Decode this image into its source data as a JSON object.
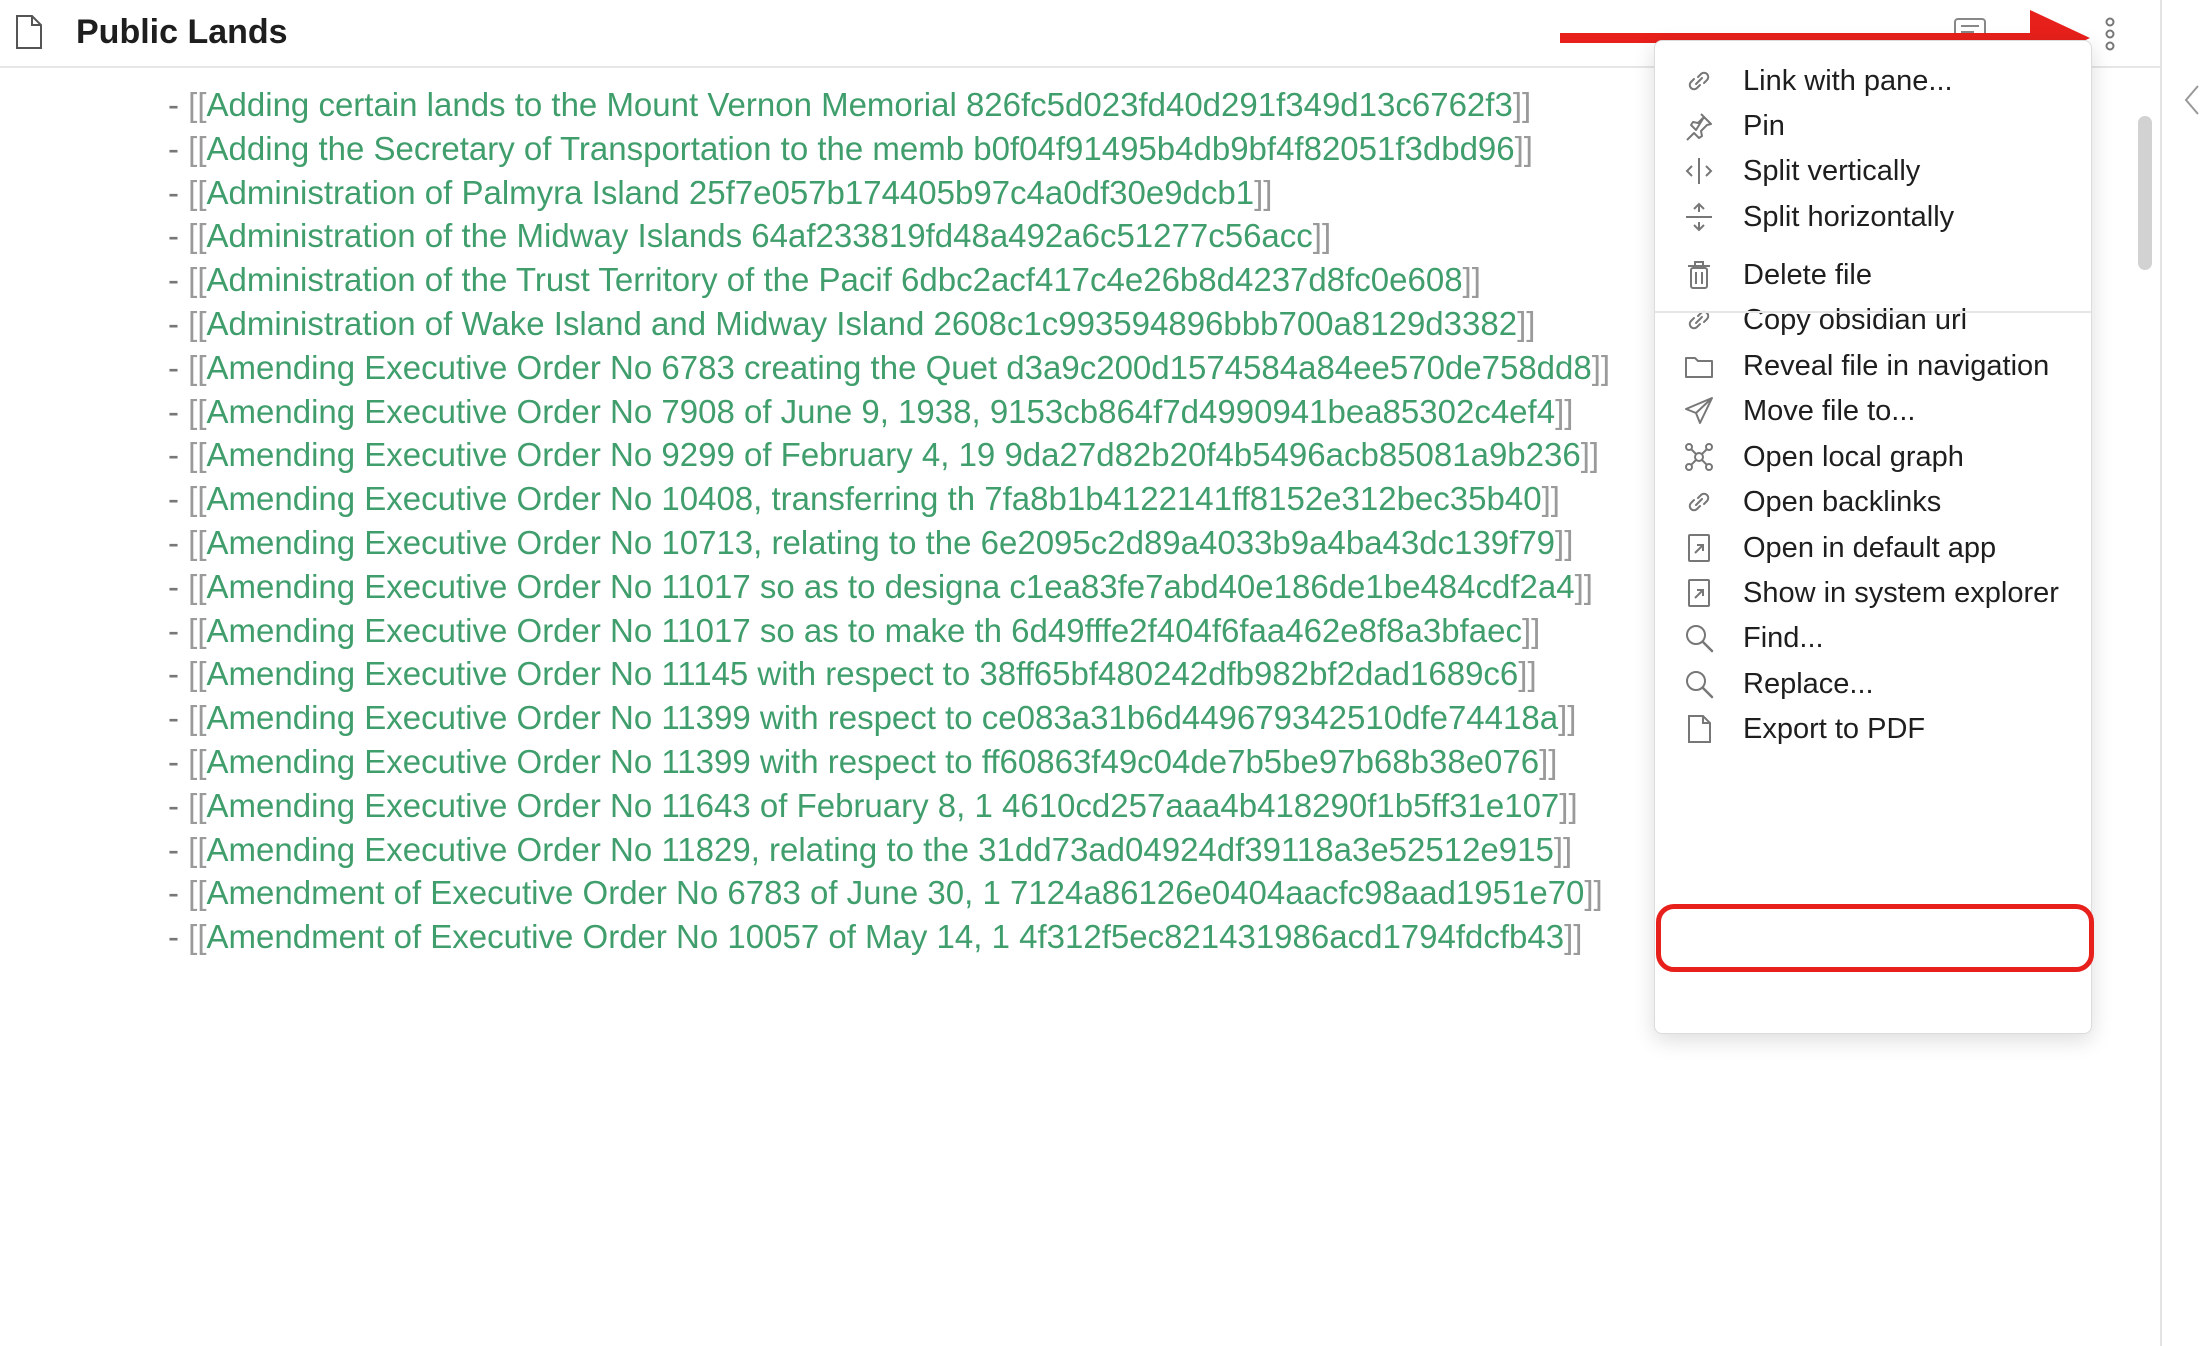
{
  "header": {
    "title": "Public Lands",
    "file_icon": "file-icon",
    "reading_icon": "reading-view-icon",
    "more_icon": "more-options-icon"
  },
  "list": {
    "bullet": "- ",
    "open": "[[",
    "close": "]]",
    "items": [
      "Adding certain lands to the Mount Vernon Memorial  826fc5d023fd40d291f349d13c6762f3",
      "Adding the Secretary of Transportation to the memb b0f04f91495b4db9bf4f82051f3dbd96",
      "Administration of Palmyra Island 25f7e057b174405b97c4a0df30e9dcb1",
      "Administration of the Midway Islands 64af233819fd48a492a6c51277c56acc",
      "Administration of the Trust Territory of the Pacif 6dbc2acf417c4e26b8d4237d8fc0e608",
      "Administration of Wake Island and Midway Island 2608c1c993594896bbb700a8129d3382",
      "Amending Executive Order No 6783 creating the Quet d3a9c200d1574584a84ee570de758dd8",
      "Amending Executive Order No 7908 of June 9, 1938,  9153cb864f7d4990941bea85302c4ef4",
      "Amending Executive Order No 9299 of February 4, 19 9da27d82b20f4b5496acb85081a9b236",
      "Amending Executive Order No 10408, transferring th 7fa8b1b4122141ff8152e312bec35b40",
      "Amending Executive Order No 10713, relating to the 6e2095c2d89a4033b9a4ba43dc139f79",
      "Amending Executive Order No 11017 so as to designa c1ea83fe7abd40e186de1be484cdf2a4",
      "Amending Executive Order No 11017 so as to make th 6d49fffe2f404f6faa462e8f8a3bfaec",
      "Amending Executive Order No 11145 with respect to  38ff65bf480242dfb982bf2dad1689c6",
      "Amending Executive Order No 11399 with respect to  ce083a31b6d449679342510dfe74418a",
      "Amending Executive Order No 11399 with respect to  ff60863f49c04de7b5be97b68b38e076",
      "Amending Executive Order No 11643 of February 8, 1 4610cd257aaa4b418290f1b5ff31e107",
      "Amending Executive Order No 11829, relating to the 31dd73ad04924df39118a3e52512e915",
      "Amendment of Executive Order No 6783 of June 30, 1 7124a86126e0404aacfc98aad1951e70",
      "Amendment of Executive Order No 10057 of May 14, 1 4f312f5ec821431986acd1794fdcfb43"
    ]
  },
  "menu": {
    "items": [
      {
        "label": "Link with pane...",
        "icon": "link-icon"
      },
      {
        "label": "Pin",
        "icon": "pin-icon"
      },
      {
        "label": "Split vertically",
        "icon": "split-vertical-icon"
      },
      {
        "label": "Split horizontally",
        "icon": "split-horizontal-icon"
      },
      {
        "label": "Delete file",
        "icon": "trash-icon"
      },
      {
        "label": "Copy obsidian url",
        "icon": "link-icon"
      },
      {
        "label": "Reveal file in navigation",
        "icon": "folder-icon"
      },
      {
        "label": "Move file to...",
        "icon": "send-icon"
      },
      {
        "label": "Open local graph",
        "icon": "graph-icon"
      },
      {
        "label": "Open backlinks",
        "icon": "link-icon"
      },
      {
        "label": "Open in default app",
        "icon": "external-file-icon"
      },
      {
        "label": "Show in system explorer",
        "icon": "external-file-icon"
      },
      {
        "label": "Find...",
        "icon": "search-icon"
      },
      {
        "label": "Replace...",
        "icon": "search-icon"
      },
      {
        "label": "Export to PDF",
        "icon": "file-icon"
      }
    ]
  },
  "colors": {
    "link": "#3f9e6c",
    "annotation": "#e8201b"
  }
}
